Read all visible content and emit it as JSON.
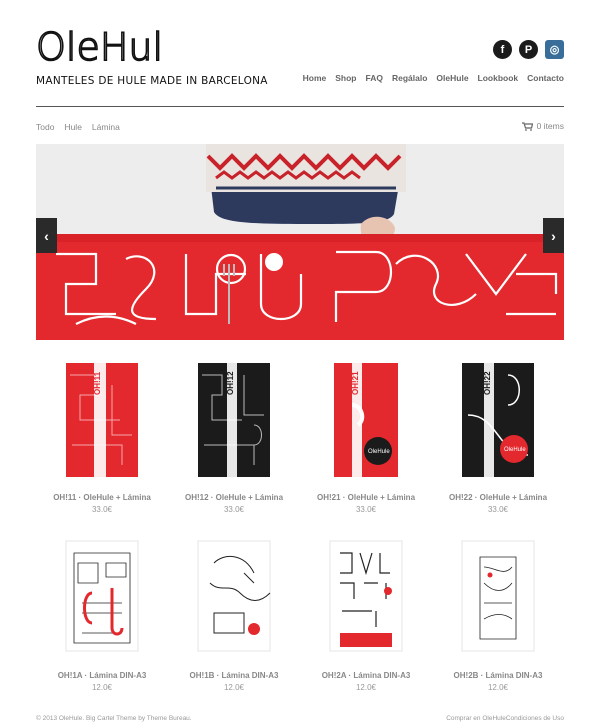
{
  "brand": {
    "logo": "OleHule",
    "tagline": "MANTELES DE HULE MADE IN BARCELONA"
  },
  "social": [
    {
      "icon": "facebook-icon",
      "glyph": "f"
    },
    {
      "icon": "pinterest-icon",
      "glyph": "P"
    },
    {
      "icon": "instagram-icon",
      "glyph": "◎"
    }
  ],
  "nav": [
    "Home",
    "Shop",
    "FAQ",
    "Regálalo",
    "OleHule",
    "Lookbook",
    "Contacto"
  ],
  "categories": [
    "Todo",
    "Hule",
    "Lámina"
  ],
  "cart": {
    "label": "0 items"
  },
  "products": [
    {
      "name": "OH!11 · OleHule + Lámina",
      "price": "33.0€",
      "code": "OH!11"
    },
    {
      "name": "OH!12 · OleHule + Lámina",
      "price": "33.0€",
      "code": "OH!12"
    },
    {
      "name": "OH!21 · OleHule + Lámina",
      "price": "33.0€",
      "code": "OH!21"
    },
    {
      "name": "OH!22 · OleHule + Lámina",
      "price": "33.0€",
      "code": "OH!22"
    },
    {
      "name": "OH!1A · Lámina DIN-A3",
      "price": "12.0€"
    },
    {
      "name": "OH!1B · Lámina DIN-A3",
      "price": "12.0€"
    },
    {
      "name": "OH!2A · Lámina DIN-A3",
      "price": "12.0€"
    },
    {
      "name": "OH!2B · Lámina DIN-A3",
      "price": "12.0€"
    }
  ],
  "footer": {
    "left_text": "© 2013 OleHule. Big Cartel Theme by",
    "left_link": "Theme Bureau.",
    "right_link1": "Comprar en OleHule",
    "right_link2": "Condiciones de Uso"
  },
  "colors": {
    "red": "#e8262b",
    "black": "#1b1b1b"
  }
}
